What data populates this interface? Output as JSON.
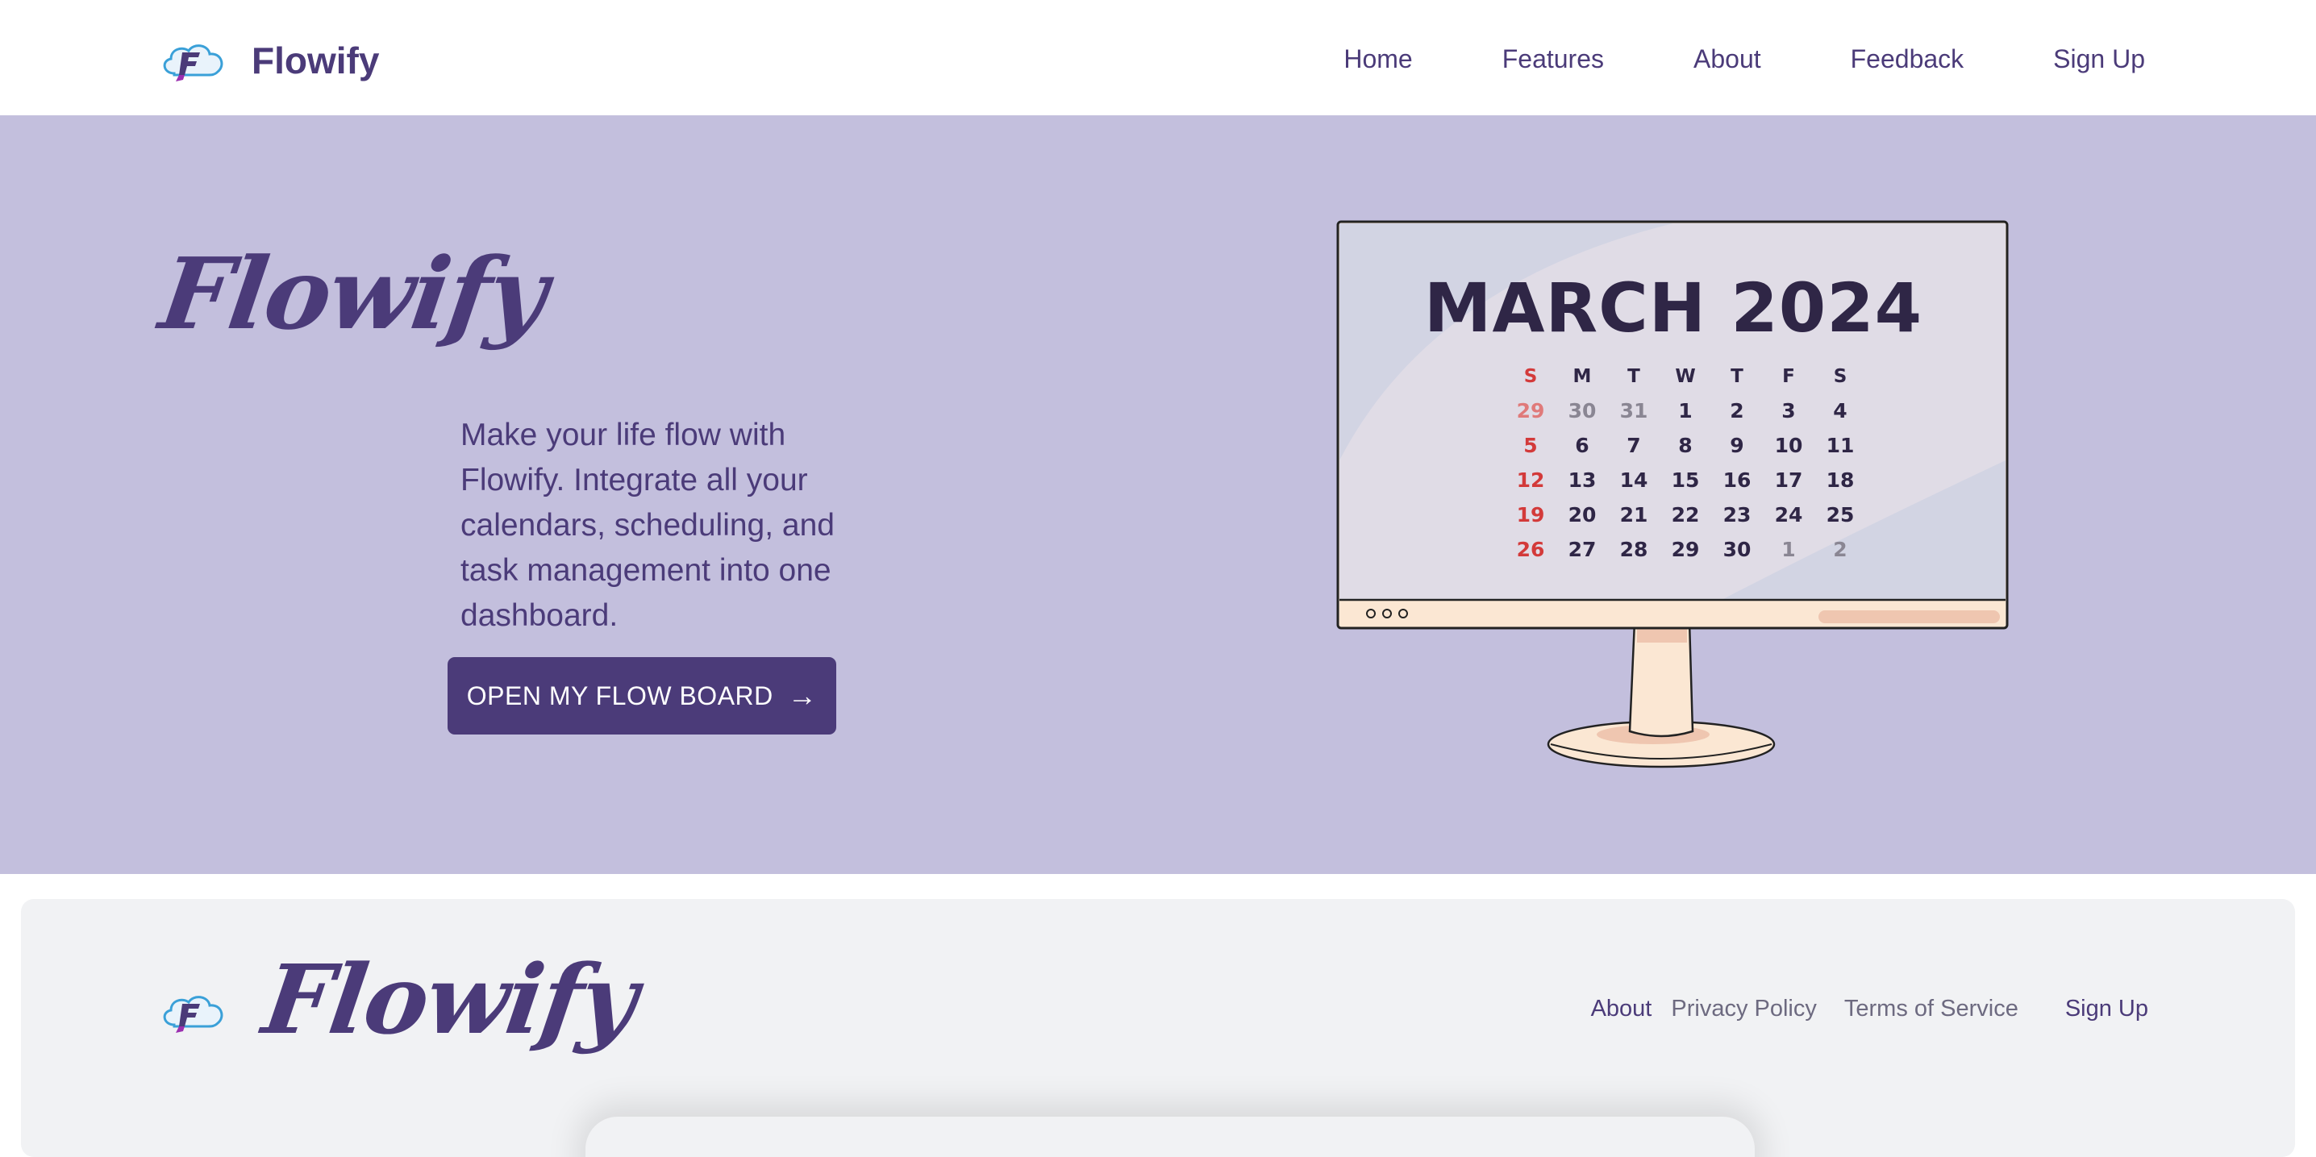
{
  "header": {
    "brand": "Flowify",
    "nav": [
      "Home",
      "Features",
      "About",
      "Feedback",
      "Sign Up"
    ]
  },
  "hero": {
    "title": "Flowify",
    "tagline": "Make your life flow with Flowify. Integrate all your calendars, scheduling, and task management into one dashboard.",
    "cta_label": "OPEN MY FLOW BOARD",
    "cta_icon": "arrow-right-icon",
    "calendar": {
      "title": "MARCH 2024",
      "weekdays": [
        "S",
        "M",
        "T",
        "W",
        "T",
        "F",
        "S"
      ],
      "weeks": [
        [
          "29",
          "30",
          "31",
          "1",
          "2",
          "3",
          "4"
        ],
        [
          "5",
          "6",
          "7",
          "8",
          "9",
          "10",
          "11"
        ],
        [
          "12",
          "13",
          "14",
          "15",
          "16",
          "17",
          "18"
        ],
        [
          "19",
          "20",
          "21",
          "22",
          "23",
          "24",
          "25"
        ],
        [
          "26",
          "27",
          "28",
          "29",
          "30",
          "1",
          "2"
        ]
      ]
    }
  },
  "footer": {
    "title": "Flowify",
    "links": {
      "about": "About",
      "privacy": "Privacy Policy",
      "terms": "Terms of Service",
      "signup": "Sign Up"
    }
  },
  "colors": {
    "brand": "#4b3b79",
    "hero_bg": "#c3bfdd",
    "footer_bg": "#f1f2f4",
    "sunday_red": "#d33a3a"
  }
}
